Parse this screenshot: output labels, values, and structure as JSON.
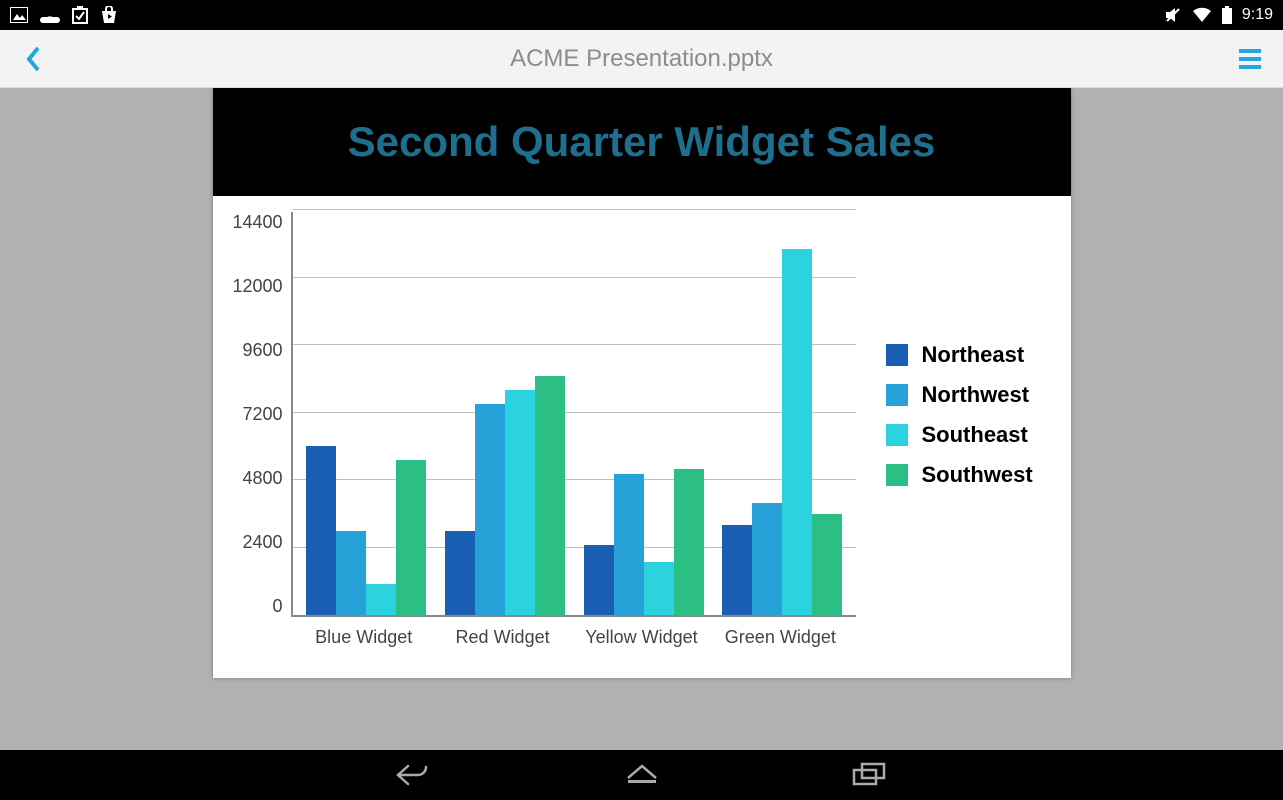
{
  "status": {
    "icons_left": [
      "image-icon",
      "upload-icon",
      "checkbox-icon",
      "shop-icon"
    ],
    "icons_right": [
      "mute-icon",
      "wifi-icon",
      "battery-icon"
    ],
    "time": "9:19"
  },
  "header": {
    "title": "ACME Presentation.pptx"
  },
  "slide": {
    "title": "Second Quarter Widget Sales"
  },
  "colors": {
    "Northeast": "#1a5fb4",
    "Northwest": "#26a2d8",
    "Southeast": "#2ad3de",
    "Southwest": "#2bbf86"
  },
  "chart_data": {
    "type": "bar",
    "title": "Second Quarter Widget Sales",
    "categories": [
      "Blue Widget",
      "Red Widget",
      "Yellow Widget",
      "Green Widget"
    ],
    "series": [
      {
        "name": "Northeast",
        "values": [
          6000,
          3000,
          2500,
          3200
        ]
      },
      {
        "name": "Northwest",
        "values": [
          3000,
          7500,
          5000,
          4000
        ]
      },
      {
        "name": "Southeast",
        "values": [
          1100,
          8000,
          1900,
          13000
        ]
      },
      {
        "name": "Southwest",
        "values": [
          5500,
          8500,
          5200,
          3600
        ]
      }
    ],
    "ylabel": "",
    "xlabel": "",
    "ylim": [
      0,
      14400
    ],
    "y_ticks": [
      14400,
      12000,
      9600,
      7200,
      4800,
      2400,
      0
    ],
    "grid": true,
    "legend_position": "right"
  }
}
